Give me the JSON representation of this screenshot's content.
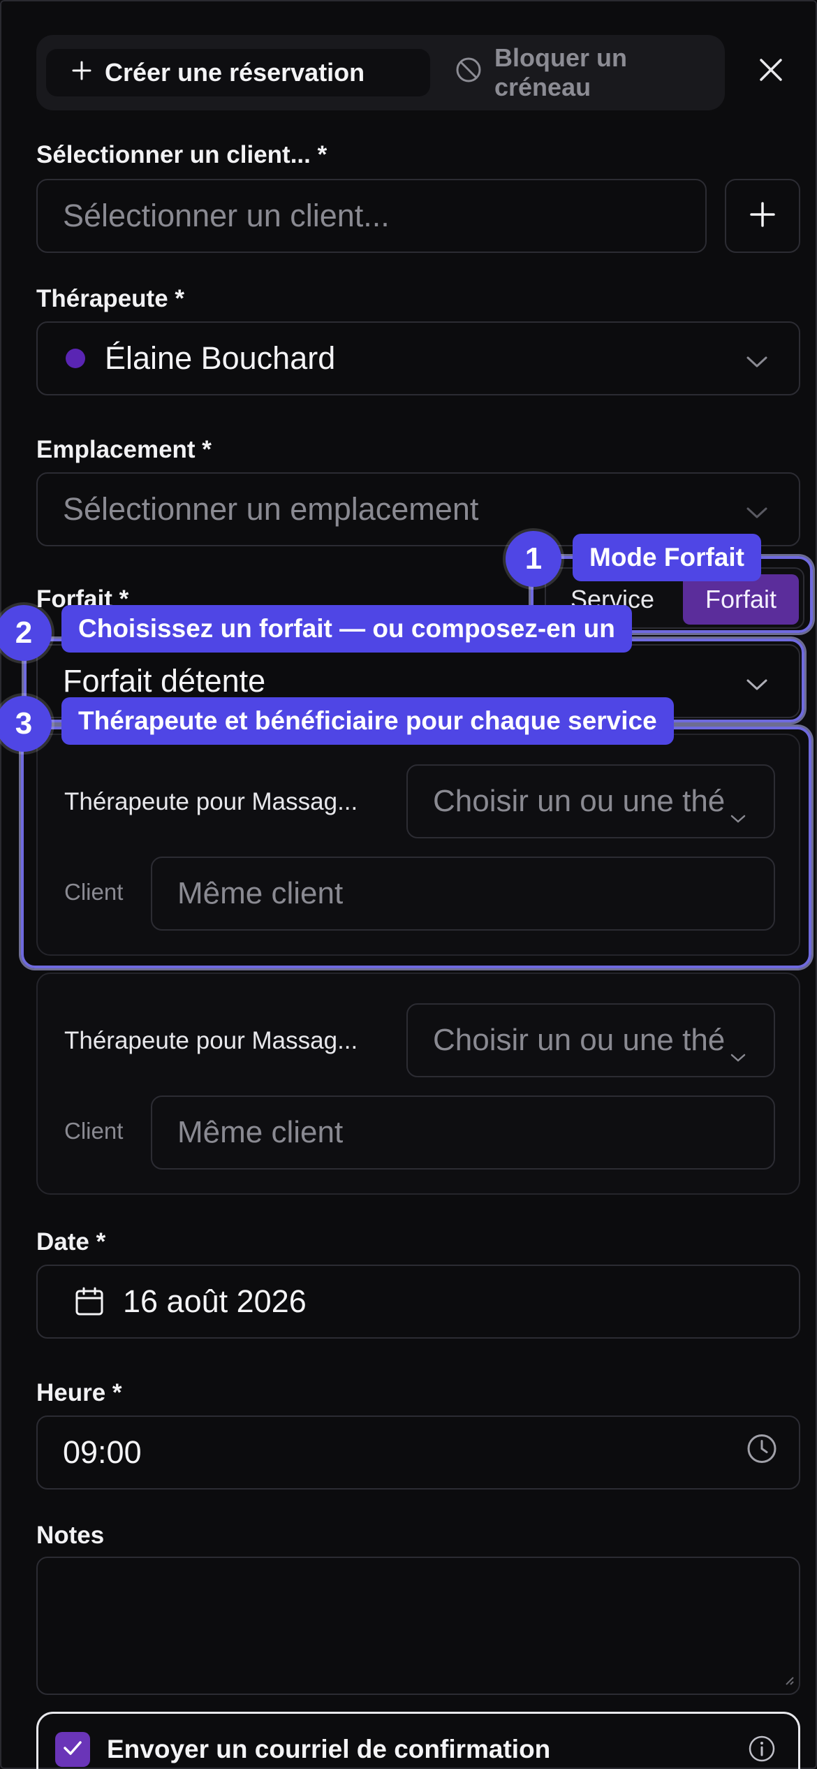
{
  "header": {
    "tab_create": "Créer une réservation",
    "tab_block": "Bloquer un créneau"
  },
  "client": {
    "label": "Sélectionner un client... *",
    "placeholder": "Sélectionner un client..."
  },
  "therapist": {
    "label": "Thérapeute *",
    "value": "Élaine Bouchard",
    "color": "#5a25b3"
  },
  "location": {
    "label": "Emplacement *",
    "placeholder": "Sélectionner un emplacement"
  },
  "package": {
    "label": "Forfait *",
    "mode_service": "Service",
    "mode_forfait": "Forfait",
    "value": "Forfait détente"
  },
  "services": [
    {
      "therapist_label": "Thérapeute pour Massag...",
      "therapist_placeholder": "Choisir un ou une thé",
      "client_label": "Client",
      "client_placeholder": "Même client"
    },
    {
      "therapist_label": "Thérapeute pour Massag...",
      "therapist_placeholder": "Choisir un ou une thé",
      "client_label": "Client",
      "client_placeholder": "Même client"
    }
  ],
  "date": {
    "label": "Date *",
    "value": "16 août 2026"
  },
  "time": {
    "label": "Heure *",
    "value": "09:00"
  },
  "notes": {
    "label": "Notes"
  },
  "confirmation": {
    "label": "Envoyer un courriel de confirmation",
    "checked": true
  },
  "annotations": [
    {
      "number": "1",
      "text": "Mode Forfait"
    },
    {
      "number": "2",
      "text": "Choisissez un forfait — ou composez-en un"
    },
    {
      "number": "3",
      "text": "Thérapeute et bénéficiaire pour chaque service"
    }
  ],
  "colors": {
    "accent": "#4f46e5",
    "toggle_active": "#5b2d9b",
    "checkbox": "#6a35b8"
  }
}
